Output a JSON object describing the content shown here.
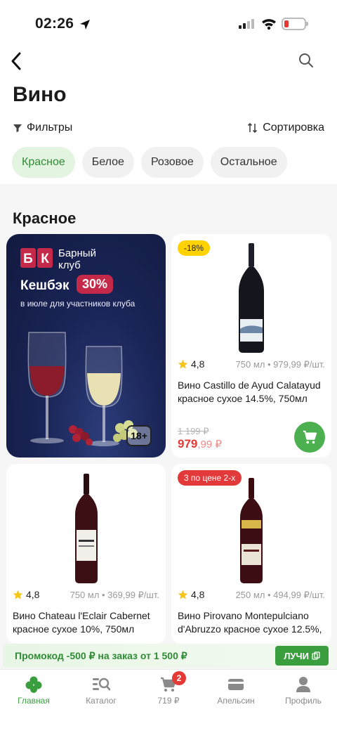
{
  "status_bar": {
    "time": "02:26"
  },
  "page": {
    "title": "Вино"
  },
  "toolbar": {
    "filters_label": "Фильтры",
    "sort_label": "Сортировка"
  },
  "chips": [
    {
      "label": "Красное",
      "active": true
    },
    {
      "label": "Белое",
      "active": false
    },
    {
      "label": "Розовое",
      "active": false
    },
    {
      "label": "Остальное",
      "active": false
    }
  ],
  "section": {
    "title": "Красное"
  },
  "promo_banner": {
    "logo_letters": "БК",
    "club_name": "Барный клуб",
    "cashback_label": "Кешбэк",
    "cashback_value": "30%",
    "subtitle": "в июле для участников клуба",
    "age_badge": "18+"
  },
  "products": [
    {
      "badge": "-18%",
      "badge_color": "#ffd200",
      "rating": "4,8",
      "meta": "750 мл • 979,99 ₽/шт.",
      "name": "Вино Castillo de Ayud Calatayud красное сухое 14.5%, 750мл",
      "old_price": "1 199 ₽",
      "price_main": "979",
      "price_cents": ",99 ₽"
    },
    {
      "badge": "",
      "rating": "4,8",
      "meta": "750 мл • 369,99 ₽/шт.",
      "name": "Вино Chateau l'Eclair Cabernet красное сухое 10%, 750мл"
    },
    {
      "badge": "3 по цене 2-х",
      "badge_color": "#e23a3a",
      "rating": "4,8",
      "meta": "250 мл • 494,99 ₽/шт.",
      "name": "Вино Pirovano Montepulciano d'Abruzzo красное сухое 12.5%,"
    }
  ],
  "promo_strip": {
    "text": "Промокод -500 ₽ на заказ от 1 500 ₽",
    "code": "ЛУЧИ"
  },
  "tabbar": {
    "items": [
      {
        "label": "Главная",
        "icon": "clover-icon",
        "active": true
      },
      {
        "label": "Каталог",
        "icon": "catalog-search-icon",
        "active": false
      },
      {
        "label": "719 ₽",
        "icon": "cart-icon",
        "active": false,
        "badge": "2"
      },
      {
        "label": "Апельсин",
        "icon": "card-icon",
        "active": false
      },
      {
        "label": "Профиль",
        "icon": "profile-icon",
        "active": false
      }
    ]
  },
  "colors": {
    "accent_green": "#3a9e3f",
    "price_red": "#e53935",
    "promo_bg": "#1a2456"
  }
}
